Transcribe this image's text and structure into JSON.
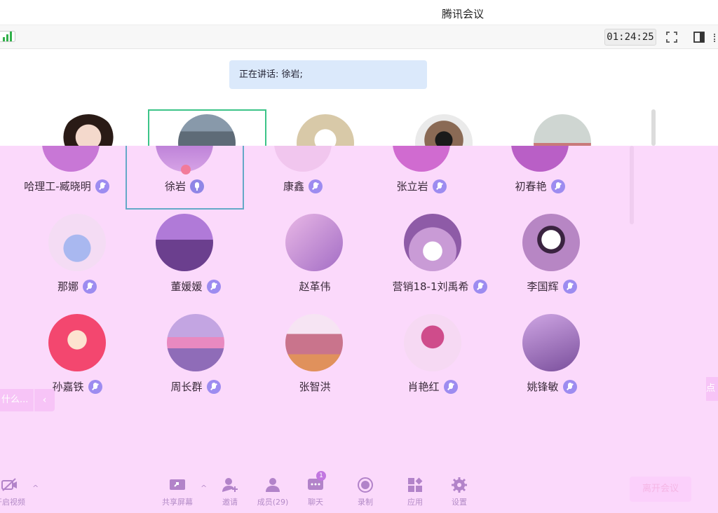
{
  "window": {
    "title": "腾讯会议"
  },
  "toolbar": {
    "timer": "01:24:25"
  },
  "speaking_banner": "正在讲话: 徐岩;",
  "participants": [
    {
      "name": "哈理工-臧晓明",
      "mic": "muted"
    },
    {
      "name": "徐岩",
      "mic": "active"
    },
    {
      "name": "康鑫",
      "mic": "muted"
    },
    {
      "name": "张立岩",
      "mic": "muted"
    },
    {
      "name": "初春艳",
      "mic": "muted"
    },
    {
      "name": "那娜",
      "mic": "muted"
    },
    {
      "name": "董媛媛",
      "mic": "muted"
    },
    {
      "name": "赵革伟",
      "mic": "none"
    },
    {
      "name": "营销18-1刘禹希",
      "mic": "muted"
    },
    {
      "name": "李国辉",
      "mic": "muted"
    },
    {
      "name": "孙嘉铁",
      "mic": "muted"
    },
    {
      "name": "周长群",
      "mic": "muted"
    },
    {
      "name": "张智洪",
      "mic": "none"
    },
    {
      "name": "肖艳红",
      "mic": "muted"
    },
    {
      "name": "姚锋敏",
      "mic": "muted"
    }
  ],
  "side_left": {
    "text": "什么...",
    "chevron": "‹"
  },
  "side_right": {
    "text": "点"
  },
  "bottom": {
    "video": "开启视频",
    "share": "共享屏幕",
    "invite": "邀请",
    "members": "成员(29)",
    "chat": "聊天",
    "chat_badge": "1",
    "record": "录制",
    "apps": "应用",
    "settings": "设置",
    "leave": "离开会议"
  },
  "colors": {
    "overlay": "#fbd9fb",
    "active_speaker": "#3cc488",
    "mic": "#8f86e6",
    "banner": "#dbe9fb"
  }
}
